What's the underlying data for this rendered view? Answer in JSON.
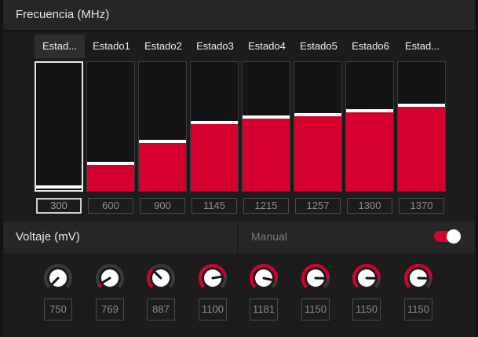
{
  "frequency": {
    "title": "Frecuencia (MHz)",
    "max_value": 1500,
    "states": [
      {
        "label": "Estad...",
        "value": "300",
        "level": 0.0,
        "selected": true
      },
      {
        "label": "Estado1",
        "value": "600",
        "level": 0.2
      },
      {
        "label": "Estado2",
        "value": "900",
        "level": 0.37
      },
      {
        "label": "Estado3",
        "value": "1145",
        "level": 0.52
      },
      {
        "label": "Estado4",
        "value": "1215",
        "level": 0.56
      },
      {
        "label": "Estado5",
        "value": "1257",
        "level": 0.58
      },
      {
        "label": "Estado6",
        "value": "1300",
        "level": 0.61
      },
      {
        "label": "Estad...",
        "value": "1370",
        "level": 0.65
      }
    ]
  },
  "voltage": {
    "title": "Voltaje (mV)",
    "manual_label": "Manual",
    "manual_enabled": true,
    "knobs": [
      {
        "value": "750",
        "level": 0.0
      },
      {
        "value": "769",
        "level": 0.05
      },
      {
        "value": "887",
        "level": 0.33
      },
      {
        "value": "1100",
        "level": 0.8
      },
      {
        "value": "1181",
        "level": 0.88
      },
      {
        "value": "1150",
        "level": 0.84
      },
      {
        "value": "1150",
        "level": 0.84
      },
      {
        "value": "1150",
        "level": 0.84
      }
    ]
  },
  "colors": {
    "accent": "#d6002f",
    "background": "#1c1c1c",
    "header": "#262626"
  }
}
